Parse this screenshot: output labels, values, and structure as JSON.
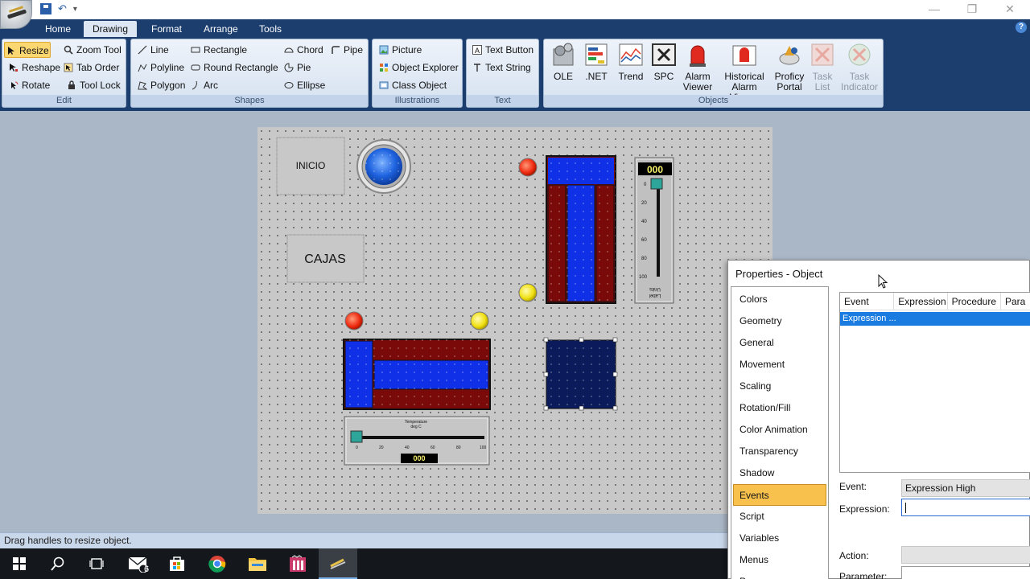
{
  "titlebar": {
    "qat_separator": "▾"
  },
  "tabs": [
    "Home",
    "Drawing",
    "Format",
    "Arrange",
    "Tools"
  ],
  "active_tab": "Drawing",
  "ribbon": {
    "edit": {
      "label": "Edit",
      "resize": "Resize",
      "zoom_tool": "Zoom Tool",
      "reshape": "Reshape",
      "tab_order": "Tab Order",
      "rotate": "Rotate",
      "tool_lock": "Tool Lock"
    },
    "shapes": {
      "label": "Shapes",
      "line": "Line",
      "rectangle": "Rectangle",
      "chord": "Chord",
      "pipe": "Pipe",
      "polyline": "Polyline",
      "round_rectangle": "Round Rectangle",
      "pie": "Pie",
      "polygon": "Polygon",
      "arc": "Arc",
      "ellipse": "Ellipse"
    },
    "illustrations": {
      "label": "Illustrations",
      "picture": "Picture",
      "object_explorer": "Object Explorer",
      "class_object": "Class Object"
    },
    "text": {
      "label": "Text",
      "text_button": "Text Button",
      "text_string": "Text String"
    },
    "objects": {
      "label": "Objects",
      "ole": "OLE",
      "net": ".NET",
      "trend": "Trend",
      "spc": "SPC",
      "alarm_viewer_1": "Alarm",
      "alarm_viewer_2": "Viewer",
      "historical_1": "Historical",
      "historical_2": "Alarm Viewer",
      "proficy_1": "Proficy",
      "proficy_2": "Portal",
      "task_list_1": "Task",
      "task_list_2": "List",
      "task_ind_1": "Task",
      "task_ind_2": "Indicator"
    }
  },
  "canvas": {
    "btn_inicio": "INICIO",
    "btn_cajas": "CAJAS",
    "vslider_readout": "000",
    "vslider_ticks": [
      "0",
      "20",
      "40",
      "60",
      "80",
      "100"
    ],
    "vslider_label": "Label",
    "vslider_units": "Units",
    "hslider_title": "Temperature",
    "hslider_units": "deg C",
    "hslider_ticks": [
      "0",
      "20",
      "40",
      "60",
      "80",
      "100"
    ],
    "hslider_readout": "000"
  },
  "statusbar": {
    "text": "Drag handles to resize object."
  },
  "taskbar": {
    "mail_badge": "6"
  },
  "properties": {
    "title": "Properties - Object",
    "categories": [
      "Colors",
      "Geometry",
      "General",
      "Movement",
      "Scaling",
      "Rotation/Fill",
      "Color Animation",
      "Transparency",
      "Shadow",
      "Events",
      "Script",
      "Variables",
      "Menus",
      "Proper"
    ],
    "selected_category": "Events",
    "grid_headers": [
      "Event",
      "Expression",
      "Procedure",
      "Para"
    ],
    "grid_rows": [
      "Expression ..."
    ],
    "event_label": "Event:",
    "event_value": "Expression High",
    "expression_label": "Expression:",
    "expression_value": "",
    "action_label": "Action:",
    "parameter_label": "Parameter:"
  },
  "colors": {
    "ribbon_dark": "#1c3e6e",
    "selected_orange": "#fbd772",
    "grid_selection": "#1a7be0"
  }
}
